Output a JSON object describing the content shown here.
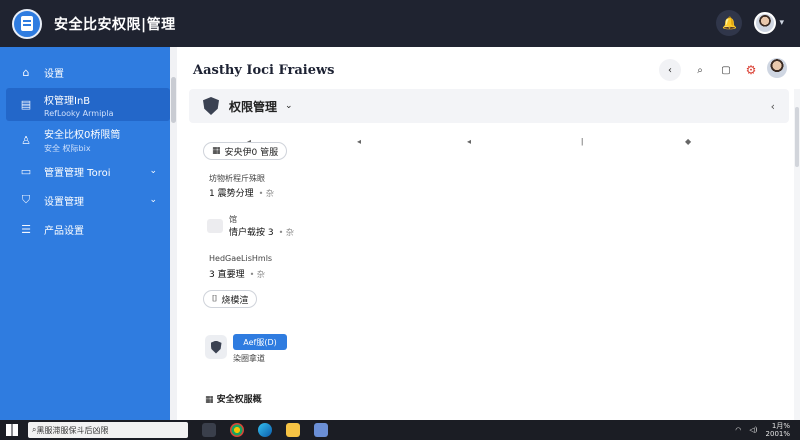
{
  "app": {
    "title": "安全比安权限|管理"
  },
  "sidebar": {
    "items": [
      {
        "label": "设置",
        "sub": "",
        "icon": "home-icon"
      },
      {
        "label": "权管理InB",
        "sub": "RefLooky Armipla",
        "icon": "document-icon"
      },
      {
        "label": "安全比权0桥限筒",
        "sub": "安全 权际bix",
        "icon": "user-icon"
      },
      {
        "label": "管置管理 Toroi",
        "sub": "",
        "icon": "folder-icon"
      },
      {
        "label": "设置管理",
        "sub": "",
        "icon": "shield-icon"
      },
      {
        "label": "产品设置",
        "sub": "",
        "icon": "list-icon"
      }
    ]
  },
  "main": {
    "page_title": "Aasthy Ioci Fraiews",
    "panel_title": "权限管理",
    "chip1": "安央伊0 管服",
    "field1_label": "坊物析程斤殊眼",
    "field1_value": "1 震势分理",
    "field1_muted": "• 杂",
    "field2_label": "馆",
    "field2_value": "情户载按 3",
    "field2_muted": "• 杂",
    "field3_label": "HedGaeLisHmls",
    "field3_value": "3 直要理",
    "field3_muted": "• 杂",
    "chip2": "烧模渲",
    "primary_button": "Aef服(D)",
    "primary_sub": "染圈拿道",
    "section_title": "安全权服概"
  },
  "taskbar": {
    "search": "黑服滞服保斗后凶限",
    "clock_time": "1月%",
    "clock_date": "2001%"
  },
  "colors": {
    "accent": "#2f7ce0",
    "titlebar": "#1f2330",
    "taskbar": "#1b1d24"
  }
}
